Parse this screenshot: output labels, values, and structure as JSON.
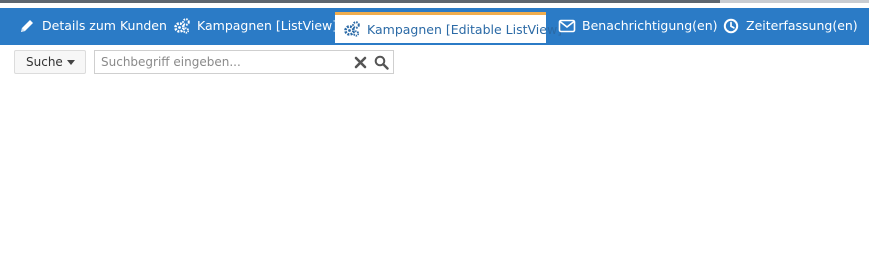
{
  "tabs": [
    {
      "label": "Details zum Kunden",
      "icon": "pencil-icon"
    },
    {
      "label": "Kampagnen [ListView]",
      "icon": "gears-icon"
    },
    {
      "label": "Kampagnen [Editable ListView]",
      "icon": "gears-icon",
      "active": true
    },
    {
      "label": "Benachrichtigung(en)",
      "icon": "envelope-icon"
    },
    {
      "label": "Zeiterfassung(en)",
      "icon": "clock-icon"
    }
  ],
  "search": {
    "dropdown_label": "Suche",
    "placeholder": "Suchbegriff eingeben...",
    "value": ""
  },
  "colors": {
    "tabbar": "#2b7bc6",
    "active_tab_accent": "#f0ad4e",
    "active_tab_text": "#2b6aa6"
  }
}
